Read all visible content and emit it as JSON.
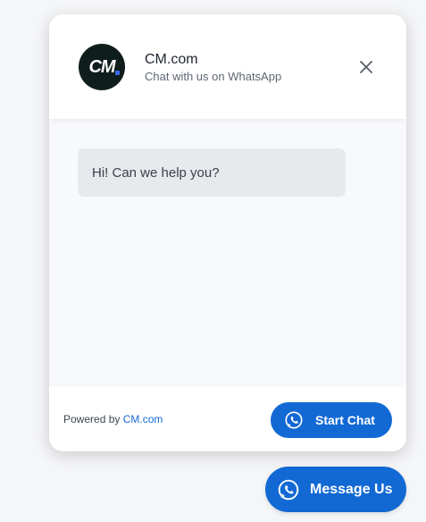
{
  "header": {
    "logo_text": "CM",
    "title": "CM.com",
    "subtitle": "Chat with us on WhatsApp",
    "close_icon": "close-icon"
  },
  "conversation": {
    "messages": [
      {
        "text": "Hi! Can we help you?"
      }
    ]
  },
  "footer": {
    "powered_prefix": "Powered by ",
    "powered_link": "CM.com",
    "start_chat_label": "Start Chat",
    "button_icon": "whatsapp-icon"
  },
  "launcher": {
    "label": "Message Us",
    "icon": "whatsapp-icon"
  },
  "colors": {
    "accent": "#1269d4",
    "logo_bg": "#0f1e1c",
    "bubble_bg": "#e8e9ed",
    "link": "#1769d6"
  }
}
